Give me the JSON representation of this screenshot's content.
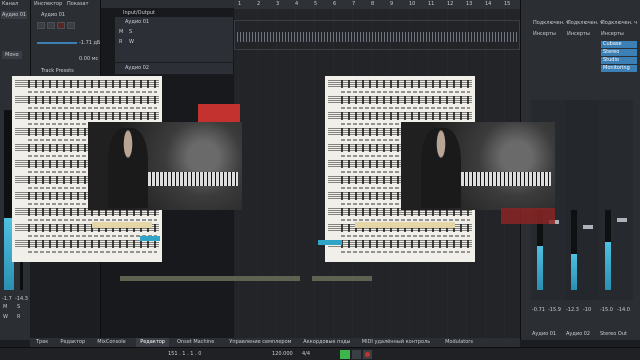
{
  "inspector": {
    "tab_channel": "Канал",
    "tab_inspector": "Инспектор",
    "tab_show": "Показат",
    "track_name_top": "Аудио 01",
    "track_name_side": "Аудио 01",
    "mono_label": "Моно",
    "gain_value": "-1.71 дБ",
    "db_value": "0.00 мс",
    "stack_label": "Track Presets",
    "side_db_left": "-1.7",
    "side_db_right": "-14.3",
    "side_m": "M",
    "side_s": "S",
    "side_w": "W",
    "side_r": "R"
  },
  "tracks": {
    "io_label": "Input/Output",
    "track1_name": "Аудио 01",
    "track2_name": "Аудио 02",
    "m_label": "M",
    "s_label": "S",
    "r_label": "R",
    "w_label": "W"
  },
  "timeline": {
    "markers": [
      "1",
      "2",
      "3",
      "4",
      "5",
      "6",
      "7",
      "8",
      "9",
      "10",
      "11",
      "12",
      "13",
      "14",
      "15"
    ]
  },
  "right_panel": {
    "col1_header": "Подключен. ч",
    "col2_header": "Подключен. ч",
    "col3_header": "Подключен. ч",
    "inserts1": "Инсерты",
    "inserts2": "Инсерты",
    "inserts3": "Инсерты",
    "plugins": [
      "Cubase",
      "Stereo",
      "Studio",
      "Monitoring"
    ],
    "ch1_name": "Аудио 01",
    "ch2_name": "Аудио 02",
    "ch3_name": "Stereo Out",
    "ch1_db": [
      "-0.71",
      "-15.9"
    ],
    "ch2_db": [
      "-12.3",
      "-10"
    ],
    "ch3_db": [
      "-15.0",
      "-14.0"
    ]
  },
  "bottom_tabs": [
    "Трек",
    "Редактор",
    "MixConsole",
    "Редактор",
    "Onset Machine",
    "Управление семплером",
    "Аккордовые пэды",
    "MIDI удалённый контроль",
    "Modulators"
  ],
  "transport": {
    "position": "151 . 1 . 1 . 0",
    "tempo": "120.000",
    "signature": "4/4"
  },
  "colors": {
    "accent_blue": "#3c7fb5",
    "meter_cyan": "#4fc1e0",
    "record_red": "#c4322f",
    "play_green": "#3cb54a"
  }
}
